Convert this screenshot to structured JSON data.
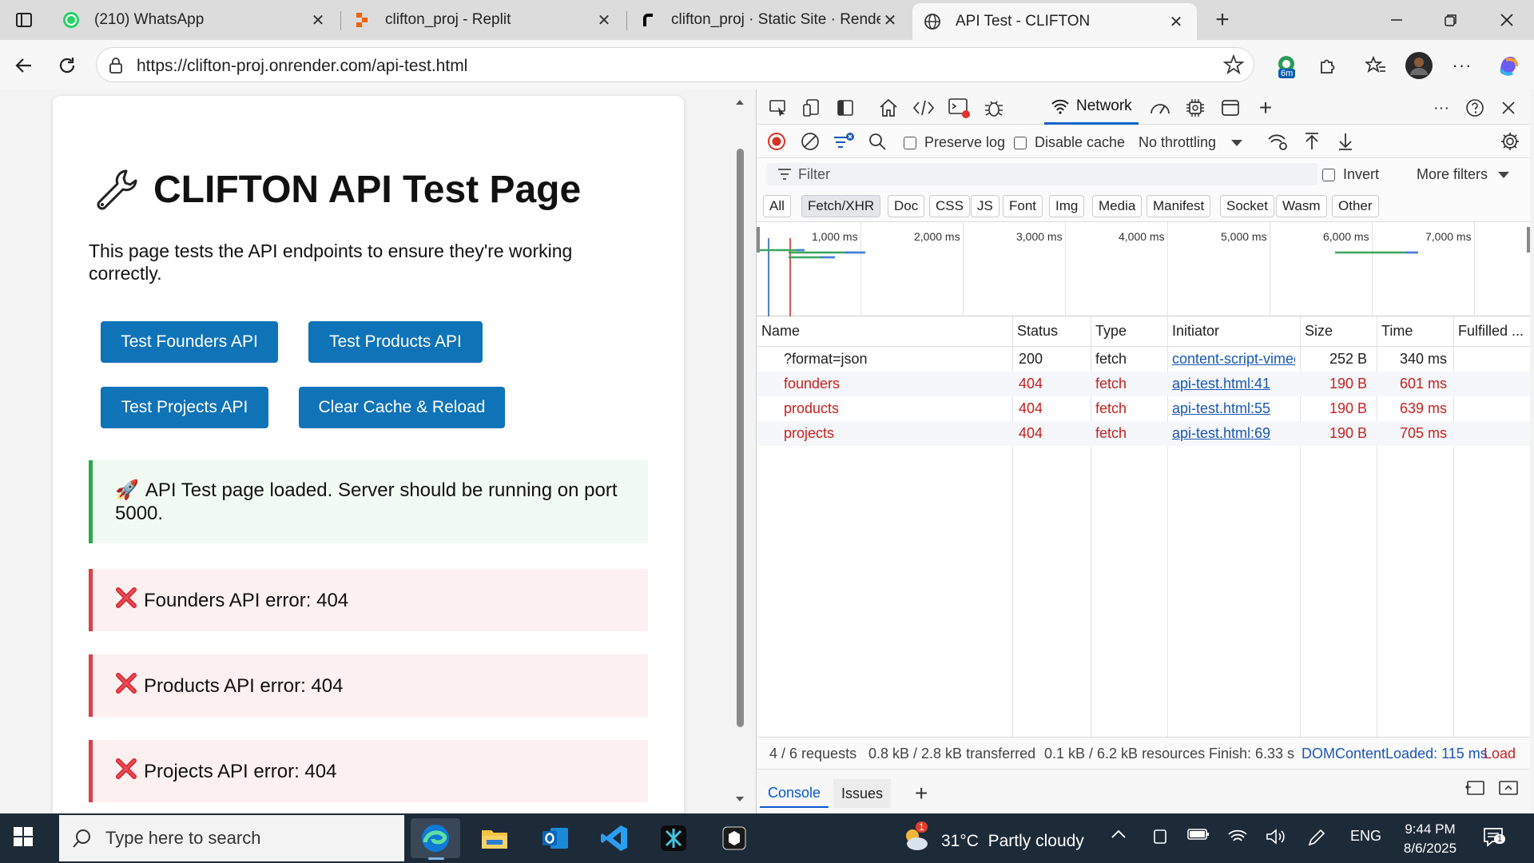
{
  "browser": {
    "tabs": [
      {
        "title": "(210) WhatsApp",
        "icon": "whatsapp-icon",
        "color": "#25d366"
      },
      {
        "title": "clifton_proj - Replit",
        "icon": "replit-icon",
        "color": "#f26207"
      },
      {
        "title": "clifton_proj · Static Site · Render",
        "icon": "render-icon",
        "color": "#000000"
      },
      {
        "title": "API Test - CLIFTON",
        "icon": "globe-icon",
        "color": "#333333"
      }
    ],
    "address": "https://clifton-proj.onrender.com/api-test.html",
    "extension_badge": "6m"
  },
  "page": {
    "title": "CLIFTON API Test Page",
    "title_icon": "wrench-icon",
    "description": "This page tests the API endpoints to ensure they're working correctly.",
    "buttons": {
      "founders": "Test Founders API",
      "products": "Test Products API",
      "projects": "Test Projects API",
      "clear": "Clear Cache & Reload"
    },
    "messages": [
      {
        "type": "info",
        "emoji": "🚀",
        "text": "API Test page loaded. Server should be running on port 5000."
      },
      {
        "type": "error",
        "emoji": "❌",
        "text": "Founders API error: 404"
      },
      {
        "type": "error",
        "emoji": "❌",
        "text": "Products API error: 404"
      },
      {
        "type": "error",
        "emoji": "❌",
        "text": "Projects API error: 404"
      }
    ],
    "accent": "#0f73b8"
  },
  "devtools": {
    "active_tab": "Network",
    "preserve_log": "Preserve log",
    "disable_cache": "Disable cache",
    "throttling": "No throttling",
    "filter_placeholder": "Filter",
    "invert": "Invert",
    "more_filters": "More filters",
    "chips": [
      "All",
      "Fetch/XHR",
      "Doc",
      "CSS",
      "JS",
      "Font",
      "Img",
      "Media",
      "Manifest",
      "Socket",
      "Wasm",
      "Other"
    ],
    "selected_chip": "Fetch/XHR",
    "timeline_labels": [
      "1,000 ms",
      "2,000 ms",
      "3,000 ms",
      "4,000 ms",
      "5,000 ms",
      "6,000 ms",
      "7,000 ms"
    ],
    "columns": [
      "Name",
      "Status",
      "Type",
      "Initiator",
      "Size",
      "Time",
      "Fulfilled ..."
    ],
    "rows": [
      {
        "name": "?format=json",
        "status": "200",
        "type": "fetch",
        "initiator": "content-script-vimeo",
        "size": "252 B",
        "time": "340 ms",
        "error": false
      },
      {
        "name": "founders",
        "status": "404",
        "type": "fetch",
        "initiator": "api-test.html:41",
        "size": "190 B",
        "time": "601 ms",
        "error": true
      },
      {
        "name": "products",
        "status": "404",
        "type": "fetch",
        "initiator": "api-test.html:55",
        "size": "190 B",
        "time": "639 ms",
        "error": true
      },
      {
        "name": "projects",
        "status": "404",
        "type": "fetch",
        "initiator": "api-test.html:69",
        "size": "190 B",
        "time": "705 ms",
        "error": true
      }
    ],
    "summary": {
      "requests": "4 / 6 requests",
      "transferred": "0.8 kB / 2.8 kB transferred",
      "resources": "0.1 kB / 6.2 kB resources",
      "finish": "Finish: 6.33 s",
      "dcl": "DOMContentLoaded: 115 ms",
      "load": "Load"
    },
    "drawer_tabs": [
      "Console",
      "Issues"
    ]
  },
  "taskbar": {
    "search_placeholder": "Type here to search",
    "weather": "31°C  Partly cloudy",
    "weather_badge": "1",
    "language": "ENG",
    "time": "9:44 PM",
    "date": "8/6/2025",
    "notifications": "1"
  }
}
